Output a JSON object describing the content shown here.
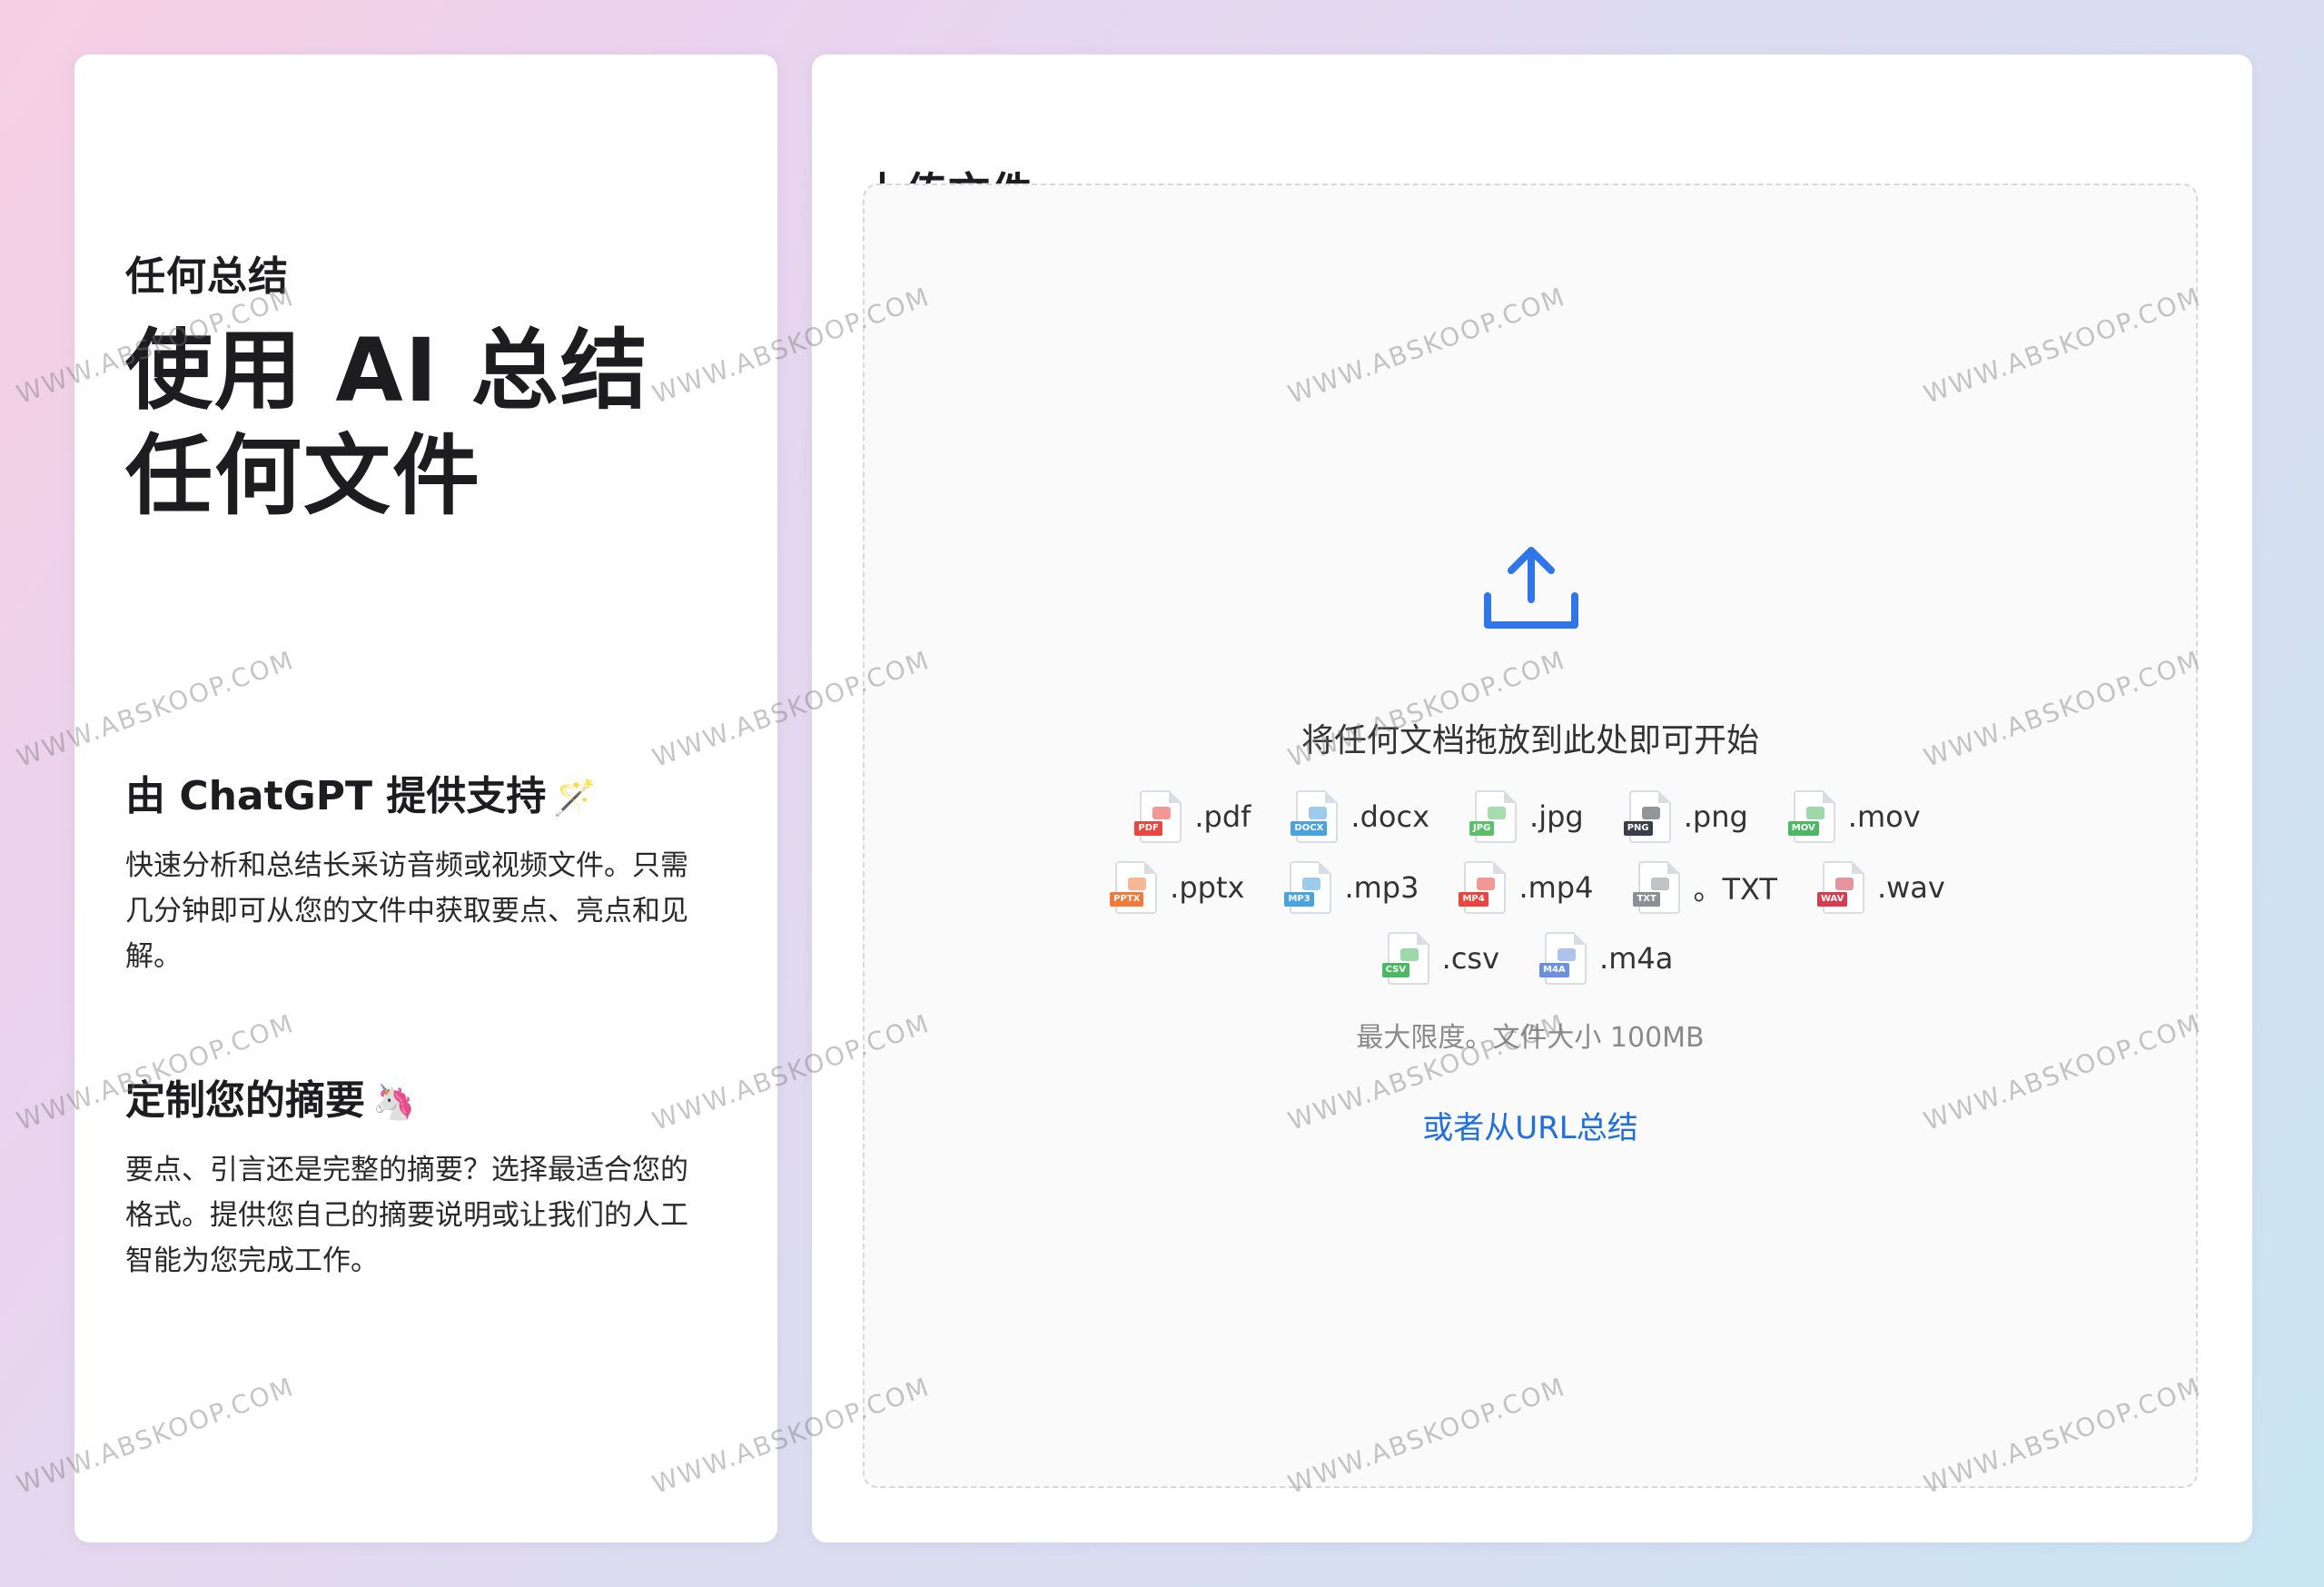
{
  "left": {
    "eyebrow": "任何总结",
    "title": "使用 AI 总结任何文件",
    "features": [
      {
        "title": "由 ChatGPT 提供支持",
        "emoji": "🪄",
        "desc": "快速分析和总结长采访音频或视频文件。只需几分钟即可从您的文件中获取要点、亮点和见解。"
      },
      {
        "title": "定制您的摘要",
        "emoji": "🦄",
        "desc": "要点、引言还是完整的摘要？选择最适合您的格式。提供您自己的摘要说明或让我们的人工智能为您完成工作。"
      }
    ]
  },
  "upload": {
    "heading": "上传文件",
    "upload_icon": "upload-arrow-icon",
    "prompt": "将任何文档拖放到此处即可开始",
    "file_types": [
      {
        "label": ".pdf",
        "tag": "PDF",
        "color": "#e8463f"
      },
      {
        "label": ".docx",
        "tag": "DOCX",
        "color": "#4aa3df"
      },
      {
        "label": ".jpg",
        "tag": "JPG",
        "color": "#5cc06a"
      },
      {
        "label": ".png",
        "tag": "PNG",
        "color": "#3a3f45"
      },
      {
        "label": ".mov",
        "tag": "MOV",
        "color": "#4cb865"
      },
      {
        "label": ".pptx",
        "tag": "PPTX",
        "color": "#f07a3c"
      },
      {
        "label": ".mp3",
        "tag": "MP3",
        "color": "#4aa3df"
      },
      {
        "label": ".mp4",
        "tag": "MP4",
        "color": "#e8463f"
      },
      {
        "label": "。TXT",
        "tag": "TXT",
        "color": "#8c9096"
      },
      {
        "label": ".wav",
        "tag": "WAV",
        "color": "#d23d4f"
      },
      {
        "label": ".csv",
        "tag": "CSV",
        "color": "#4cb865"
      },
      {
        "label": ".m4a",
        "tag": "M4A",
        "color": "#6d8fe0"
      }
    ],
    "limit": "最大限度。文件大小 100MB",
    "url_link": "或者从URL总结"
  },
  "watermark": "WWW.ABSKOOP.COM"
}
